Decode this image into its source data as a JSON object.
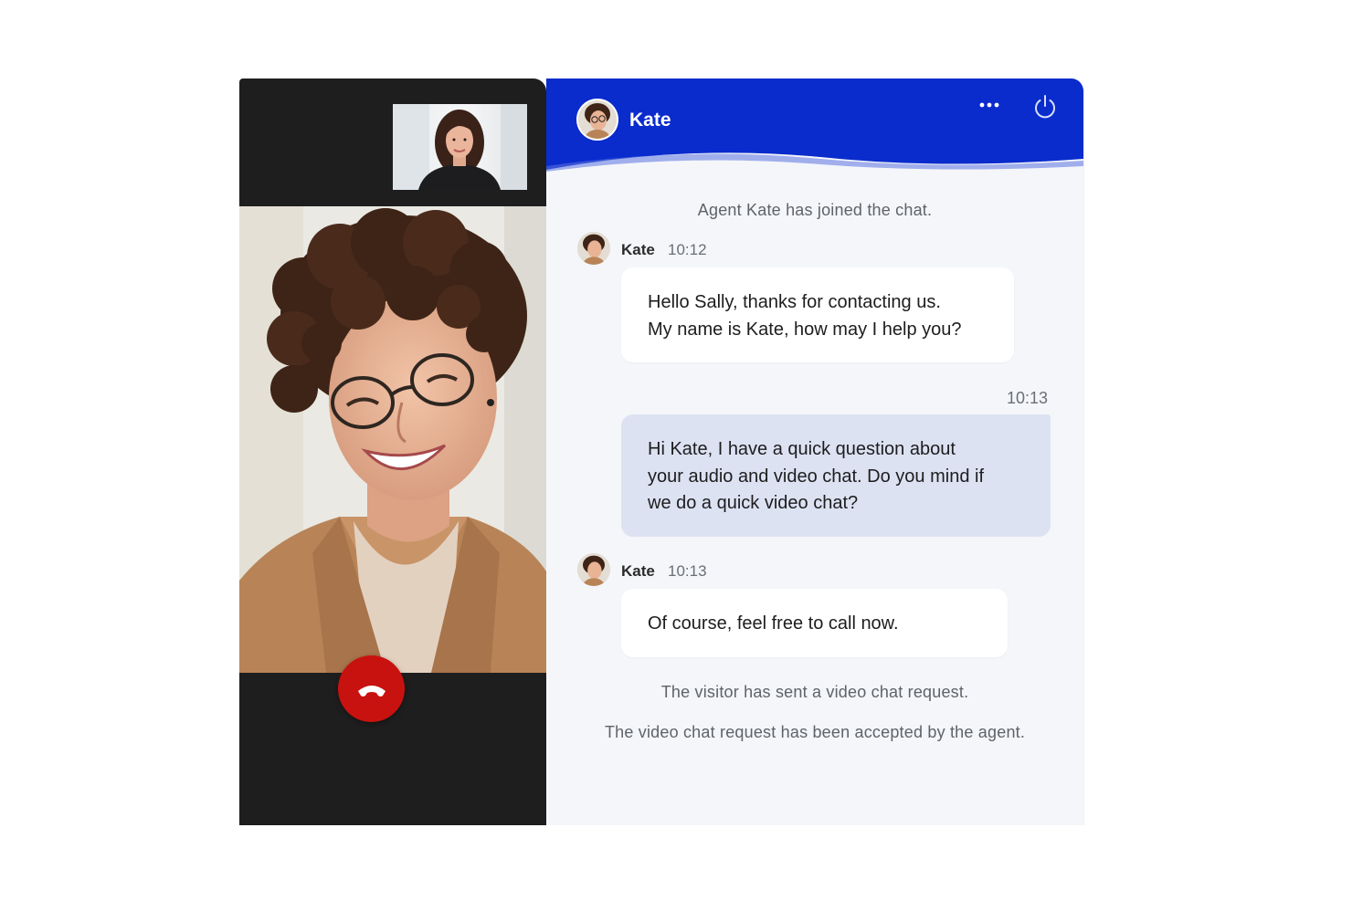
{
  "chat": {
    "agent_name": "Kate",
    "system_joined": "Agent Kate has joined the chat.",
    "messages": [
      {
        "sender": "Kate",
        "time": "10:12",
        "lines": [
          "Hello Sally, thanks for contacting us.",
          "My name is Kate, how may I help you?"
        ]
      },
      {
        "sender": "",
        "time": "10:13",
        "lines": [
          "Hi Kate, I have a quick question about",
          "your audio and video chat. Do you mind if",
          "we do a quick video chat?"
        ]
      },
      {
        "sender": "Kate",
        "time": "10:13",
        "lines": [
          "Of course, feel free to call now."
        ]
      }
    ],
    "system_video_request": "The visitor has sent a video chat request.",
    "system_video_accepted": "The video chat request has been accepted by the agent."
  },
  "icons": {
    "menu": "more-horizontal-icon",
    "power": "power-icon",
    "hangup": "phone-hangup-icon"
  },
  "colors": {
    "header_blue": "#0a2ccd",
    "hangup_red": "#c8120f",
    "visitor_bubble": "#dde2f2",
    "chat_background": "#f4f6fa"
  }
}
